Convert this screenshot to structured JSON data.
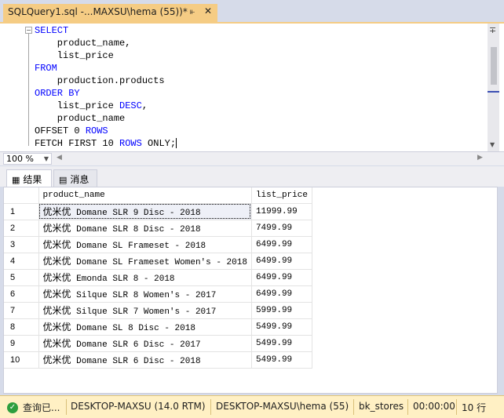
{
  "tab": {
    "title": "SQLQuery1.sql -...MAXSU\\hema (55))*",
    "pin_icon": "pin-icon",
    "close_icon": "close-icon"
  },
  "editor": {
    "lines": [
      [
        {
          "t": "SELECT",
          "k": true
        }
      ],
      [
        {
          "t": "    product_name,",
          "k": false
        }
      ],
      [
        {
          "t": "    list_price",
          "k": false
        }
      ],
      [
        {
          "t": "FROM",
          "k": true
        }
      ],
      [
        {
          "t": "    production.products",
          "k": false
        }
      ],
      [
        {
          "t": "ORDER BY",
          "k": true
        }
      ],
      [
        {
          "t": "    list_price ",
          "k": false
        },
        {
          "t": "DESC",
          "k": true
        },
        {
          "t": ",",
          "k": false
        }
      ],
      [
        {
          "t": "    product_name",
          "k": false
        }
      ],
      [
        {
          "t": "OFFSET 0 ",
          "k": false
        },
        {
          "t": "ROWS",
          "k": true
        }
      ],
      [
        {
          "t": "FETCH FIRST 10 ",
          "k": false
        },
        {
          "t": "ROWS",
          "k": true
        },
        {
          "t": " ONLY;",
          "k": false
        }
      ]
    ],
    "keyword_color": "#0000ff"
  },
  "zoom": {
    "value": "100 %"
  },
  "results": {
    "tabs": [
      {
        "label": "结果",
        "icon": "grid-icon"
      },
      {
        "label": "消息",
        "icon": "messages-icon"
      }
    ],
    "columns": [
      "product_name",
      "list_price"
    ],
    "rows": [
      {
        "num": "1",
        "prefix": "优米优",
        "name": " Domane SLR 9 Disc - 2018",
        "price": "11999.99"
      },
      {
        "num": "2",
        "prefix": "优米优",
        "name": " Domane SLR 8 Disc - 2018",
        "price": "7499.99"
      },
      {
        "num": "3",
        "prefix": "优米优",
        "name": " Domane SL Frameset - 2018",
        "price": "6499.99"
      },
      {
        "num": "4",
        "prefix": "优米优",
        "name": " Domane SL Frameset Women's - 2018",
        "price": "6499.99"
      },
      {
        "num": "5",
        "prefix": "优米优",
        "name": " Emonda SLR 8 - 2018",
        "price": "6499.99"
      },
      {
        "num": "6",
        "prefix": "优米优",
        "name": " Silque SLR 8 Women's - 2017",
        "price": "6499.99"
      },
      {
        "num": "7",
        "prefix": "优米优",
        "name": " Silque SLR 7 Women's - 2017",
        "price": "5999.99"
      },
      {
        "num": "8",
        "prefix": "优米优",
        "name": " Domane SL 8 Disc - 2018",
        "price": "5499.99"
      },
      {
        "num": "9",
        "prefix": "优米优",
        "name": " Domane SLR 6 Disc - 2017",
        "price": "5499.99"
      },
      {
        "num": "10",
        "prefix": "优米优",
        "name": " Domane SLR 6 Disc - 2018",
        "price": "5499.99"
      }
    ]
  },
  "status": {
    "query_state": "查询已...",
    "server": "DESKTOP-MAXSU (14.0 RTM)",
    "user": "DESKTOP-MAXSU\\hema (55)",
    "database": "bk_stores",
    "elapsed": "00:00:00",
    "row_count": "10 行",
    "bar_color": "#fff0c4"
  }
}
